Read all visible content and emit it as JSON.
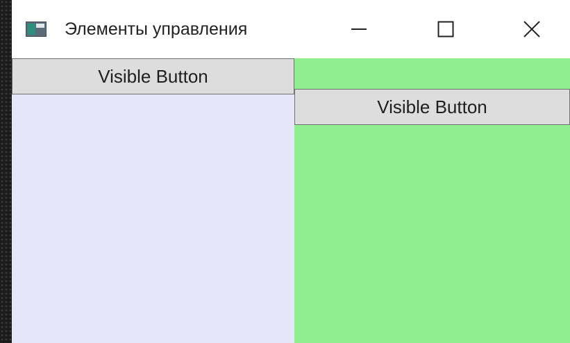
{
  "window": {
    "title": "Элементы управления",
    "controls": {
      "minimize_icon": "minimize-icon",
      "maximize_icon": "maximize-icon",
      "close_icon": "close-icon"
    }
  },
  "left_panel": {
    "background": "#e6e6fa",
    "button_label": "Visible Button"
  },
  "right_panel": {
    "background": "#90ee90",
    "button_label": "Visible Button"
  },
  "colors": {
    "button_face": "#dddddd",
    "button_border": "#707070",
    "titlebar": "#ffffff"
  }
}
